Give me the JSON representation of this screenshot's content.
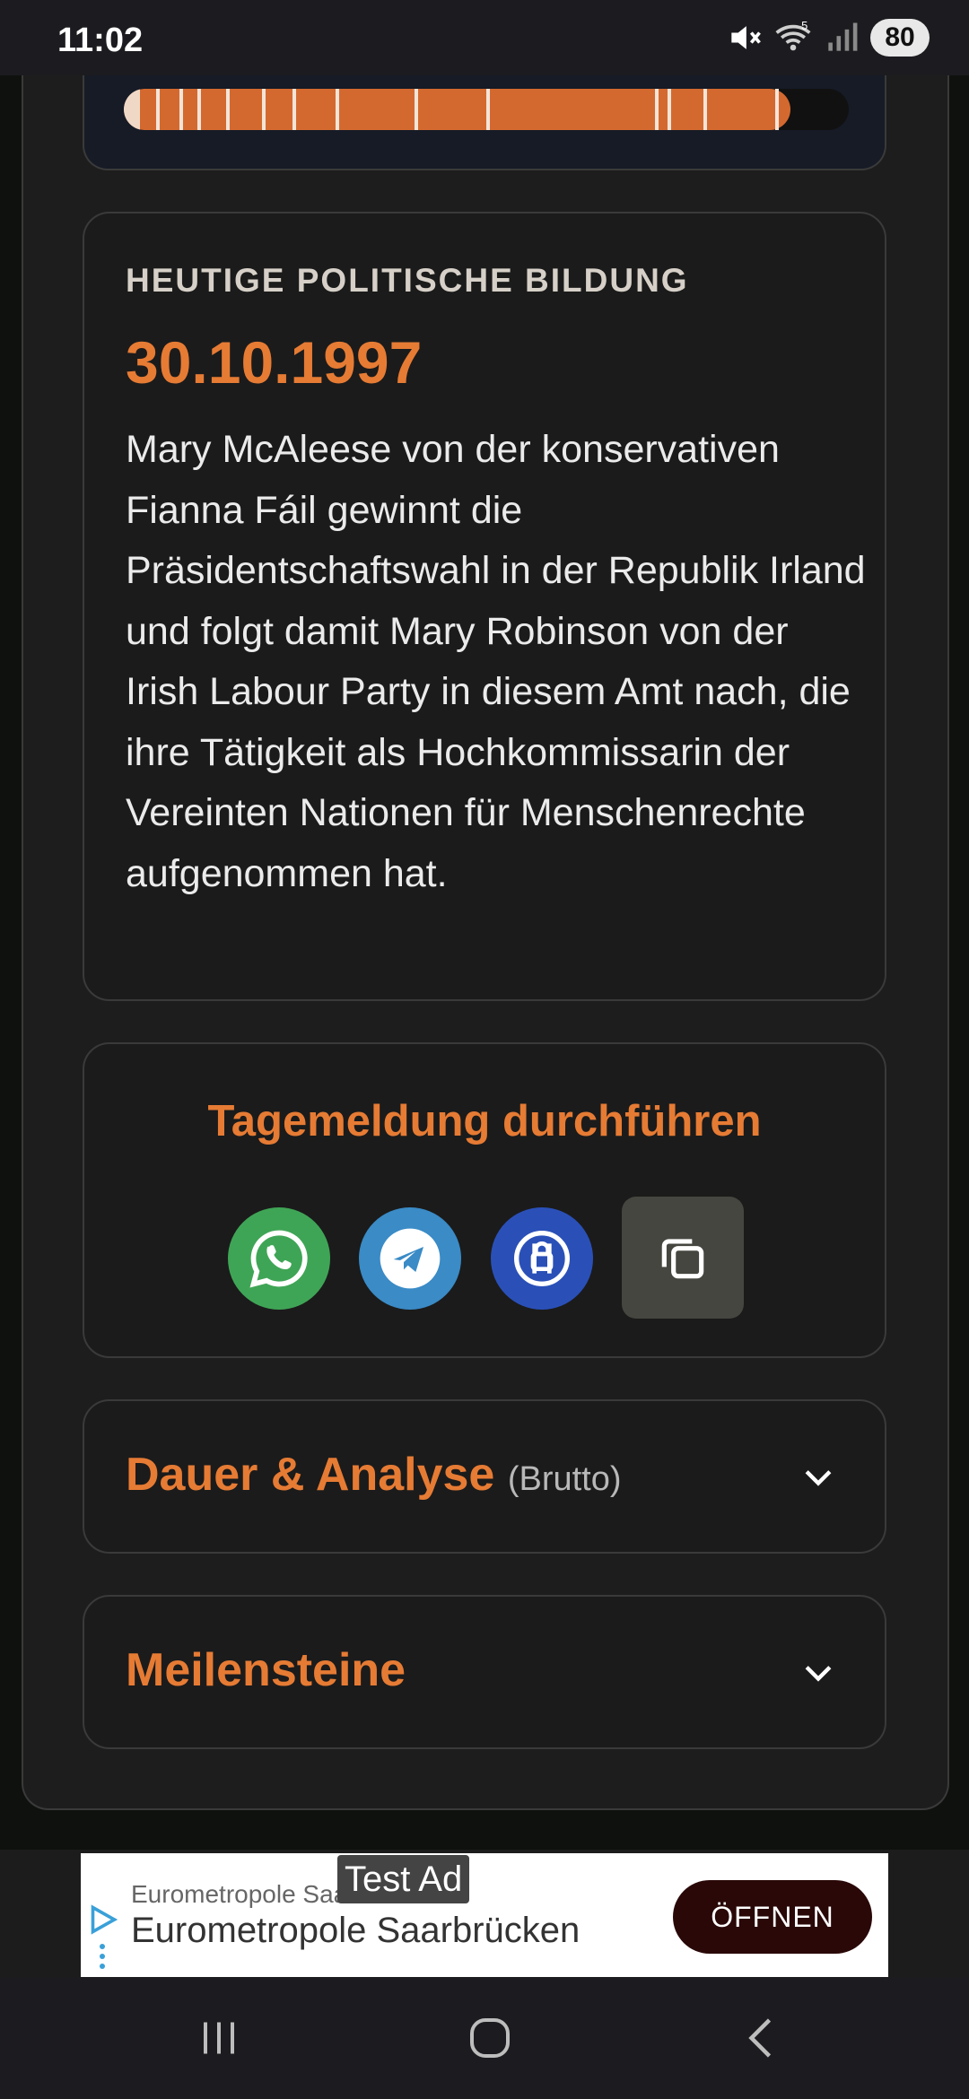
{
  "status_bar": {
    "time": "11:02",
    "battery": "80",
    "wifi_badge": "5",
    "icons": [
      "mute-icon",
      "wifi-icon",
      "signal-icon",
      "battery-icon"
    ]
  },
  "progress": {
    "fill_fraction": 0.92,
    "color": "#d4692f"
  },
  "event": {
    "section_label": "HEUTIGE POLITISCHE BILDUNG",
    "date": "30.10.1997",
    "text": "Mary McAleese von der konservativen Fianna Fáil gewinnt die Präsidentschaftswahl in der Republik Irland und folgt damit Mary Robinson von der Irish Labour Party in diesem Amt nach, die ihre Tätigkeit als Hochkommissarin der Vereinten Nationen für Menschenrechte aufgenommen hat."
  },
  "share": {
    "title": "Tagemeldung durchführen",
    "buttons": [
      {
        "name": "whatsapp-icon",
        "color": "#3fa556"
      },
      {
        "name": "telegram-icon",
        "color": "#3a8bc6"
      },
      {
        "name": "threema-icon",
        "color": "#2a50b8"
      },
      {
        "name": "copy-icon",
        "color": "#45463f"
      }
    ]
  },
  "accordions": {
    "analysis_title": "Dauer & Analyse",
    "analysis_suffix": "(Brutto)",
    "milestones_title": "Meilensteine"
  },
  "ad": {
    "badge": "Test Ad",
    "small_title": "Eurometropole Saarbrücken",
    "big_title": "Eurometropole Saarbrücken",
    "cta": "ÖFFNEN"
  },
  "colors": {
    "accent": "#e67b34",
    "card_bg": "#1b1b1b",
    "page_bg": "#0f110e"
  }
}
